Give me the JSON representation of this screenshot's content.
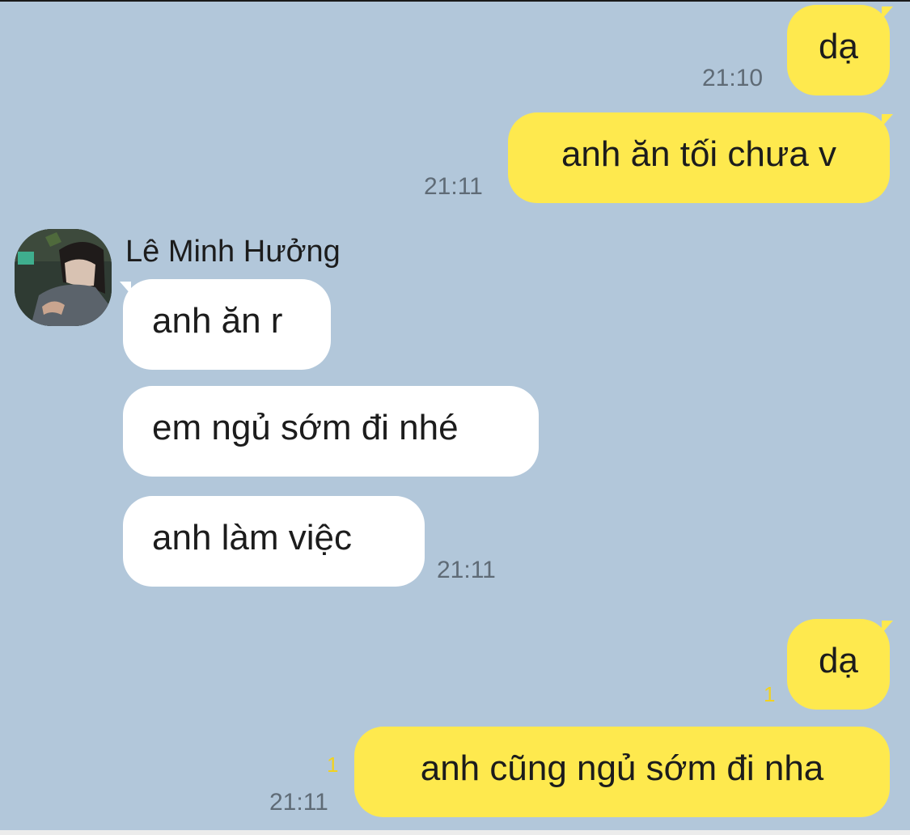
{
  "conversation": {
    "messages": [
      {
        "from": "me",
        "text": "dạ",
        "time": "21:10"
      },
      {
        "from": "me",
        "text": "anh ăn tối chưa v",
        "time": "21:11"
      },
      {
        "from": "other",
        "sender": "Lê Minh Hưởng",
        "text": "anh ăn r"
      },
      {
        "from": "other",
        "text": "em ngủ sớm đi nhé"
      },
      {
        "from": "other",
        "text": "anh làm việc",
        "time": "21:11"
      },
      {
        "from": "me",
        "text": "dạ",
        "unread": "1"
      },
      {
        "from": "me",
        "text": "anh cũng ngủ sớm đi nha",
        "unread": "1",
        "time": "21:11"
      }
    ]
  },
  "colors": {
    "background": "#b2c7da",
    "my_bubble": "#fee94e",
    "their_bubble": "#ffffff",
    "unread_count": "#f2d21e",
    "timestamp": "#5f6b76"
  },
  "icons": {
    "avatar": "contact-avatar-photo"
  }
}
